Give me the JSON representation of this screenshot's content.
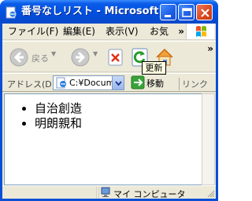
{
  "window": {
    "title": "番号なしリスト - Microsoft...",
    "colors": {
      "titlebar": "#0050e0",
      "close": "#d8461c",
      "chrome": "#ece9d8"
    },
    "controls": {
      "minimize_icon": "minimize-icon",
      "maximize_icon": "maximize-icon",
      "close_icon": "close-icon"
    }
  },
  "menubar": {
    "items": [
      {
        "label": "ファイル(F)"
      },
      {
        "label": "編集(E)"
      },
      {
        "label": "表示(V)"
      },
      {
        "label": "お気"
      }
    ],
    "overflow_icon": "chevron-double-right-icon"
  },
  "toolbar": {
    "back_label": "戻る",
    "forward_icon": "forward-arrow-icon",
    "stop_icon": "stop-icon",
    "refresh_icon": "refresh-icon",
    "home_icon": "home-icon",
    "overflow_icon": "chevron-double-right-icon",
    "tooltip": "更新"
  },
  "addressbar": {
    "label": "アドレス(D)",
    "value": "C:¥Docum",
    "go_label": "移動",
    "links_label": "リンク"
  },
  "content": {
    "items": [
      "自治創造",
      "明朗親和"
    ]
  },
  "statusbar": {
    "zone_label": "マイ コンピュータ"
  }
}
